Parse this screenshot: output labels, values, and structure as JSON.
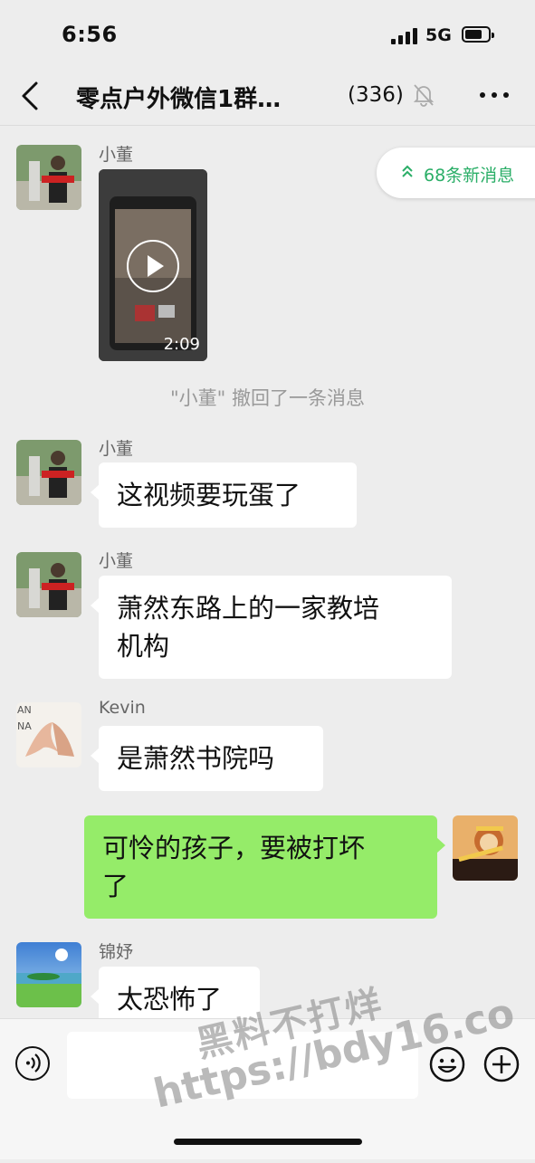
{
  "status_bar": {
    "time": "6:56",
    "network": "5G"
  },
  "nav": {
    "title": "零点户外微信1群…",
    "member_count": "(336)"
  },
  "new_messages": {
    "label": "68条新消息"
  },
  "messages": [
    {
      "sender": "小董",
      "video_duration": "2:09"
    },
    {
      "recall_notice": "\"小董\" 撤回了一条消息"
    },
    {
      "sender": "小董",
      "text": "这视频要玩蛋了"
    },
    {
      "sender": "小董",
      "text_line1": "萧然东路上的一家教培",
      "text_line2": "机构"
    },
    {
      "sender": "Kevin",
      "text": "是萧然书院吗"
    },
    {
      "text_line1": "可怜的孩子，要被打坏",
      "text_line2": "了"
    },
    {
      "sender": "锦妤",
      "text": "太恐怖了"
    }
  ],
  "watermark": {
    "line1": "黑料不打烊",
    "line2": "https://bdy16.co"
  },
  "colors": {
    "accent_green": "#2aae67",
    "outgoing_bubble": "#95ec69",
    "background": "#ededed"
  },
  "icons": [
    "back-icon",
    "mute-bell-icon",
    "more-icon",
    "chevron-up-icon",
    "play-icon",
    "voice-icon",
    "emoji-icon",
    "plus-icon"
  ]
}
